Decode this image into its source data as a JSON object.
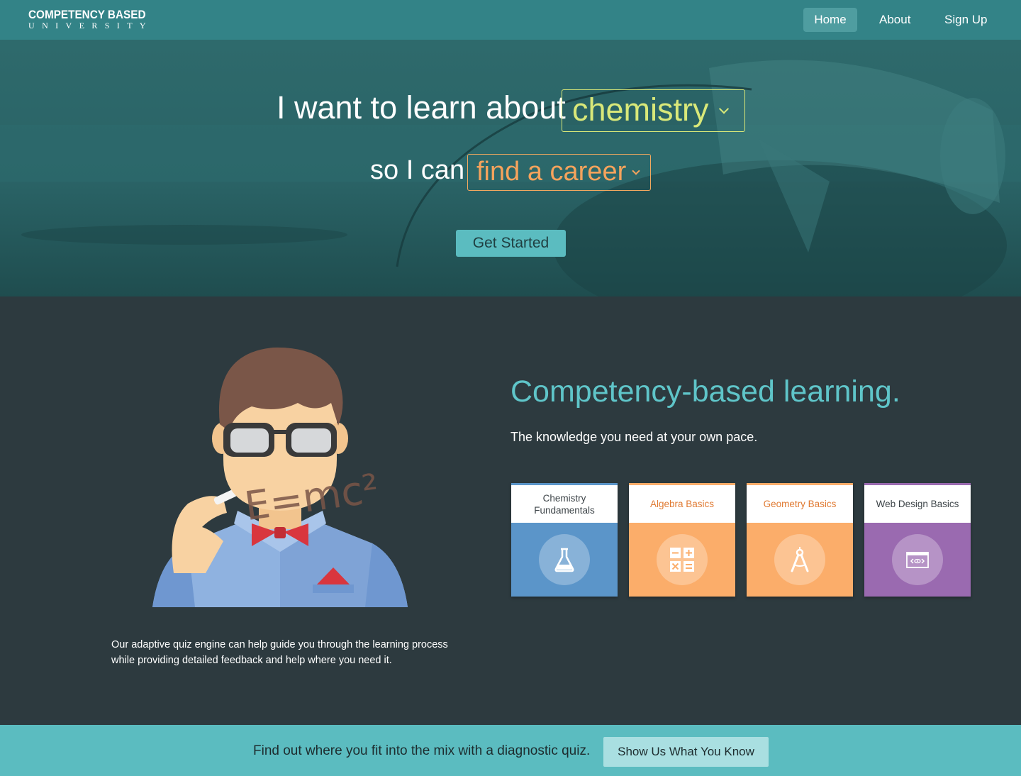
{
  "nav": {
    "logo_top": "COMPETENCY BASED",
    "logo_bottom": "UNIVERSITY",
    "links": [
      "Home",
      "About",
      "Sign Up"
    ],
    "active": "Home"
  },
  "hero": {
    "line1": "I want to learn about",
    "subject_value": "chemistry",
    "line2": "so I can",
    "goal_value": "find a career",
    "cta_label": "Get Started"
  },
  "middle": {
    "headline": "Competency-based learning.",
    "tagline": "The knowledge you need at your own pace.",
    "mascot_formula": "E=mc²",
    "description": "Our adaptive quiz engine can help guide you through the learning process while providing detailed feedback and help where you need it.",
    "courses": [
      {
        "title": "Chemistry Fundamentals",
        "icon": "flask-icon",
        "color": "#5b95c9",
        "title_color": "#3d4448"
      },
      {
        "title": "Algebra Basics",
        "icon": "calculator-icon",
        "color": "#fbad6a",
        "title_color": "#e07a32"
      },
      {
        "title": "Geometry Basics",
        "icon": "compass-icon",
        "color": "#fbad6a",
        "title_color": "#e07a32"
      },
      {
        "title": "Web Design Basics",
        "icon": "browser-code-icon",
        "color": "#9a6ab0",
        "title_color": "#3d4448"
      }
    ]
  },
  "cta": {
    "text": "Find out where you fit into the mix with a diagnostic quiz.",
    "button_label": "Show Us What You Know"
  },
  "colors": {
    "nav_bg": "#338387",
    "hero_bg": "#265d5f",
    "accent_teal": "#5bbcc0",
    "subject_color": "#d9e879",
    "goal_color": "#f6a35c",
    "dark_bg": "#2d3a3f"
  }
}
